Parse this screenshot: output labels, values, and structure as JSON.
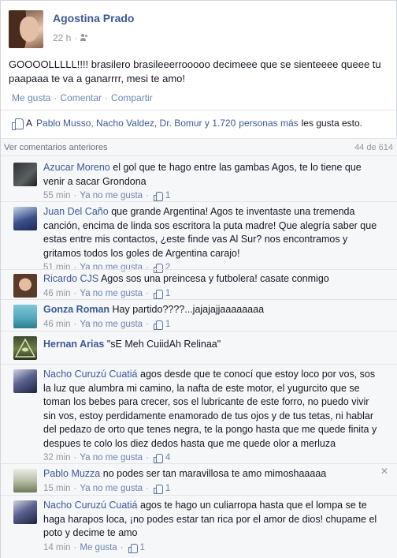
{
  "post": {
    "author": "Agostina Prado",
    "time": "22 h",
    "meta_sep": "·",
    "text": "GOOOOLLLLL!!!! brasilero brasileeerrooooo decimeee que se sienteeee queee tu paapaaa te va a ganarrrr, mesi te amo!",
    "actions": [
      "Me gusta",
      "Comentar",
      "Compartir"
    ],
    "action_sep": "·"
  },
  "likes": {
    "prefix": "A",
    "names": "Pablo Musso, Nacho Valdez, Dr. Bomur y 1.720",
    "people": "personas más",
    "tail": "les gusta esto."
  },
  "previous": {
    "label": "Ver comentarios anteriores",
    "count": "44 de 614"
  },
  "icons": {
    "like": "thumbs-up-icon",
    "audience": "friends-icon",
    "close": "close-icon"
  },
  "colors": {
    "link": "#3b5998",
    "muted": "#9197a3",
    "bg_comments": "#f6f7f9"
  },
  "comments": [
    {
      "author": "Azucar Moreno",
      "text": "el gol que te hago entre las gambas Agos, te lo tiene que venir a sacar Grondona",
      "time": "55 min",
      "action": "Ya no me gusta",
      "likes": "1",
      "bold": false
    },
    {
      "author": "Juan Del Caño",
      "text": "que grande Argentina! Agos te inventaste una tremenda canción, encima de linda sos escritora la puta madre! Que alegría saber que estas entre mis contactos, ¿este finde vas Al Sur? nos encontramos y gritamos todos los goles de Argentina carajo!",
      "time": "51 min",
      "action": "Ya no me gusta",
      "likes": "2",
      "bold": false
    },
    {
      "author": "Ricardo CJS",
      "text": "Agos sos una preincesa y futbolera! casate conmigo",
      "time": "46 min",
      "action": "Ya no me gusta",
      "likes": "1",
      "bold": false
    },
    {
      "author": "Gonza Roman",
      "text": "Hay partido????...jajajajjaaaaaaaa",
      "time": "46 min",
      "action": "Ya no me gusta",
      "likes": "1",
      "bold": true
    },
    {
      "author": "Hernan Arias",
      "text": "\"sE Meh CuiidAh Relinaa\"",
      "time": "",
      "action": "",
      "likes": "",
      "bold": true
    },
    {
      "author": "Nacho Curuzú Cuatiá",
      "text": "agos desde que te conocí que estoy loco por vos, sos la luz que alumbra mi camino, la nafta de este motor, el yugurcito que se toman los bebes para crecer, sos el lubricante de este forro, no puedo vivir sin vos, estoy perdidamente enamorado de tus ojos y de tus tetas, ni hablar del pedazo de orto que tenes negra, te la pongo hasta que me quede finita y despues te colo los diez dedos hasta que me quede olor a merluza",
      "time": "32 min",
      "action": "Ya no me gusta",
      "likes": "4",
      "bold": false
    },
    {
      "author": "Pablo Muzza",
      "text": "no podes ser tan maravillosa te amo mimoshaaaaa",
      "time": "15 min",
      "action": "Ya no me gusta",
      "likes": "1",
      "bold": false
    },
    {
      "author": "Nacho Curuzú Cuatiá",
      "text": "agos te hago un culiarropa hasta que el lompa se te haga harapos loca, ¡no podes estar tan rica por el amor de dios! chupame el poto y decime te amo",
      "time": "14 min",
      "action": "Me gusta",
      "likes": "1",
      "bold": false
    }
  ]
}
